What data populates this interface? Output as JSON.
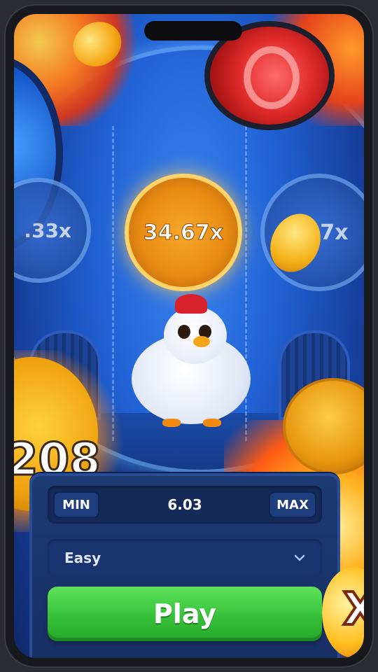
{
  "game": {
    "multipliers": {
      "left": ".33x",
      "center": "34.67x",
      "right": "3 .7x"
    },
    "partial_score": "208",
    "x_badge": "X"
  },
  "controls": {
    "bet": {
      "min_label": "MIN",
      "value": "6.03",
      "max_label": "MAX"
    },
    "difficulty": {
      "selected": "Easy",
      "icon": "chevron-down-icon"
    },
    "play_label": "Play"
  },
  "colors": {
    "play_button": "#37c13a",
    "panel": "#1d3a75",
    "active_multiplier": "#e98c14"
  }
}
